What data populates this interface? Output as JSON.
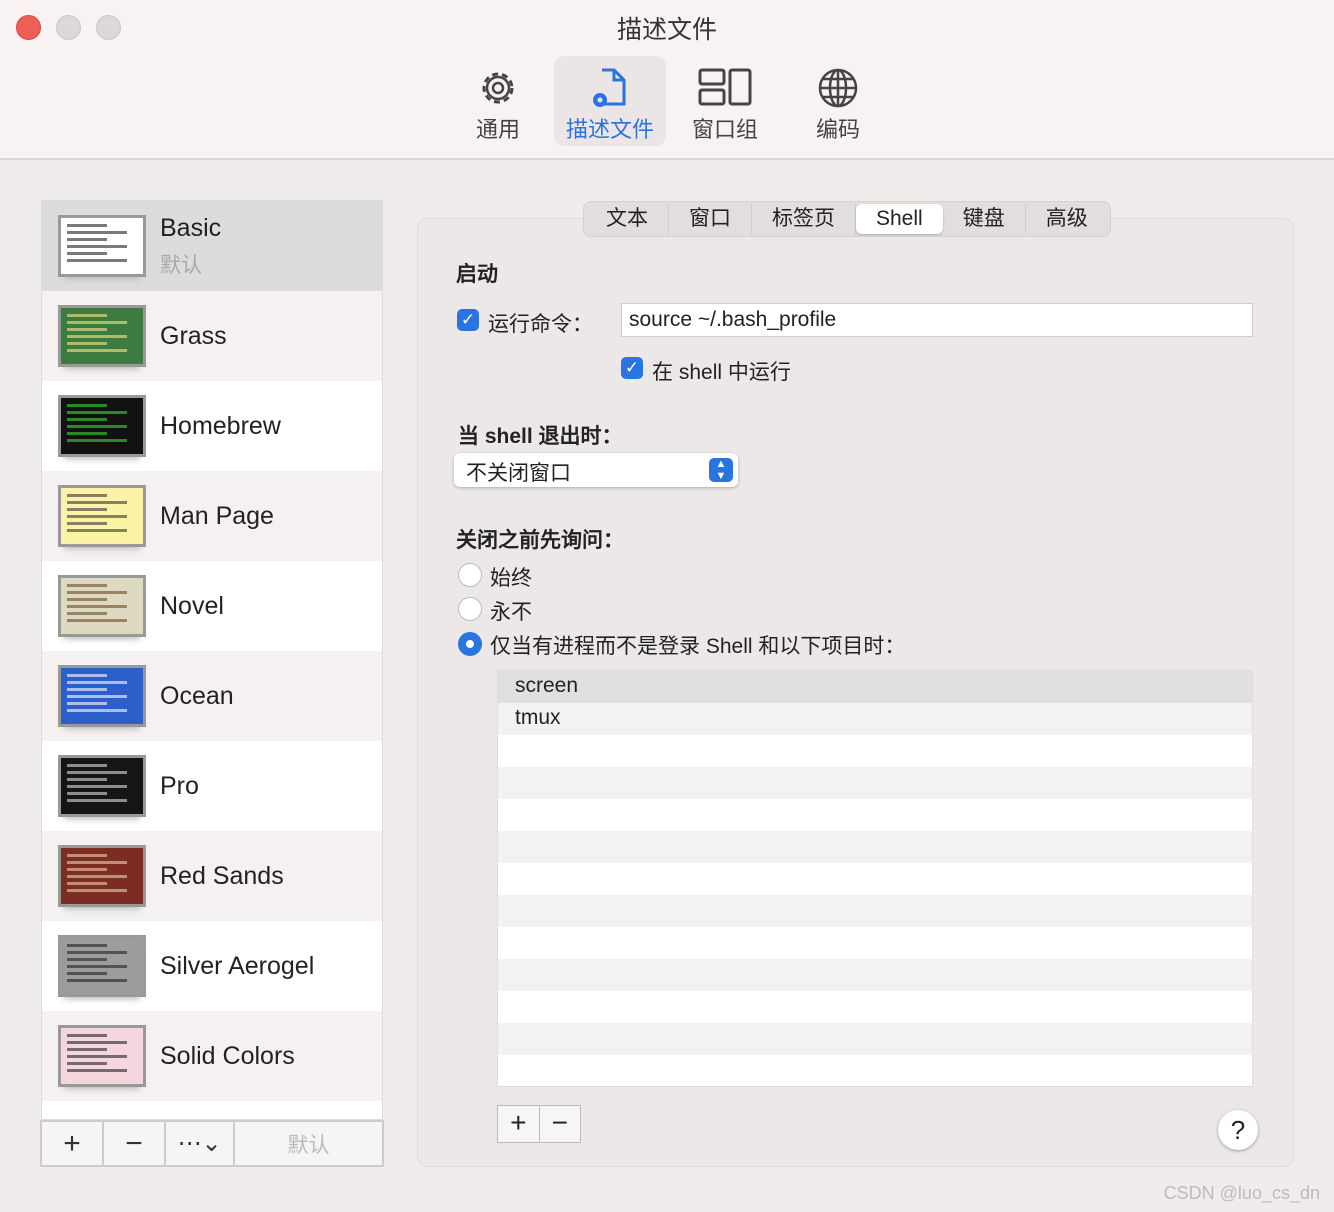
{
  "window": {
    "title": "描述文件"
  },
  "toolbar": [
    {
      "label": "通用",
      "icon": "gear-icon"
    },
    {
      "label": "描述文件",
      "icon": "profile-doc-icon",
      "selected": true
    },
    {
      "label": "窗口组",
      "icon": "window-group-icon"
    },
    {
      "label": "编码",
      "icon": "globe-icon"
    }
  ],
  "profiles": [
    {
      "name": "Basic",
      "sub": "默认",
      "bg": "#ffffff",
      "fg": "#222222",
      "selected": true
    },
    {
      "name": "Grass",
      "bg": "#3e7b41",
      "fg": "#f5e98a"
    },
    {
      "name": "Homebrew",
      "bg": "#111111",
      "fg": "#33dd33"
    },
    {
      "name": "Man Page",
      "bg": "#fcf3a6",
      "fg": "#333333"
    },
    {
      "name": "Novel",
      "bg": "#dedac2",
      "fg": "#6a4a2a"
    },
    {
      "name": "Ocean",
      "bg": "#2d5fcb",
      "fg": "#ffffff"
    },
    {
      "name": "Pro",
      "bg": "#151515",
      "fg": "#dddddd"
    },
    {
      "name": "Red Sands",
      "bg": "#7c2c22",
      "fg": "#e8d6a6"
    },
    {
      "name": "Silver Aerogel",
      "bg": "#9c9c9c",
      "fg": "#222222"
    },
    {
      "name": "Solid Colors",
      "bg": "#f6d6de",
      "fg": "#222222"
    }
  ],
  "sidebar_bottom": {
    "add": "+",
    "remove": "−",
    "more": "⋯⌄",
    "default": "默认"
  },
  "tabs": [
    "文本",
    "窗口",
    "标签页",
    "Shell",
    "键盘",
    "高级"
  ],
  "selected_tab": "Shell",
  "startup": {
    "heading": "启动",
    "run_command_label": "运行命令：",
    "run_command_checked": true,
    "command": "source ~/.bash_profile",
    "run_in_shell_label": "在 shell 中运行",
    "run_in_shell_checked": true
  },
  "on_exit": {
    "heading": "当 shell 退出时：",
    "value": "不关闭窗口"
  },
  "ask_before_close": {
    "heading": "关闭之前先询问：",
    "options": [
      "始终",
      "永不",
      "仅当有进程而不是登录 Shell 和以下项目时："
    ],
    "selected": 2
  },
  "processes": [
    "screen",
    "tmux"
  ],
  "process_buttons": {
    "add": "+",
    "remove": "−"
  },
  "help": "?",
  "watermark": "CSDN @luo_cs_dn"
}
